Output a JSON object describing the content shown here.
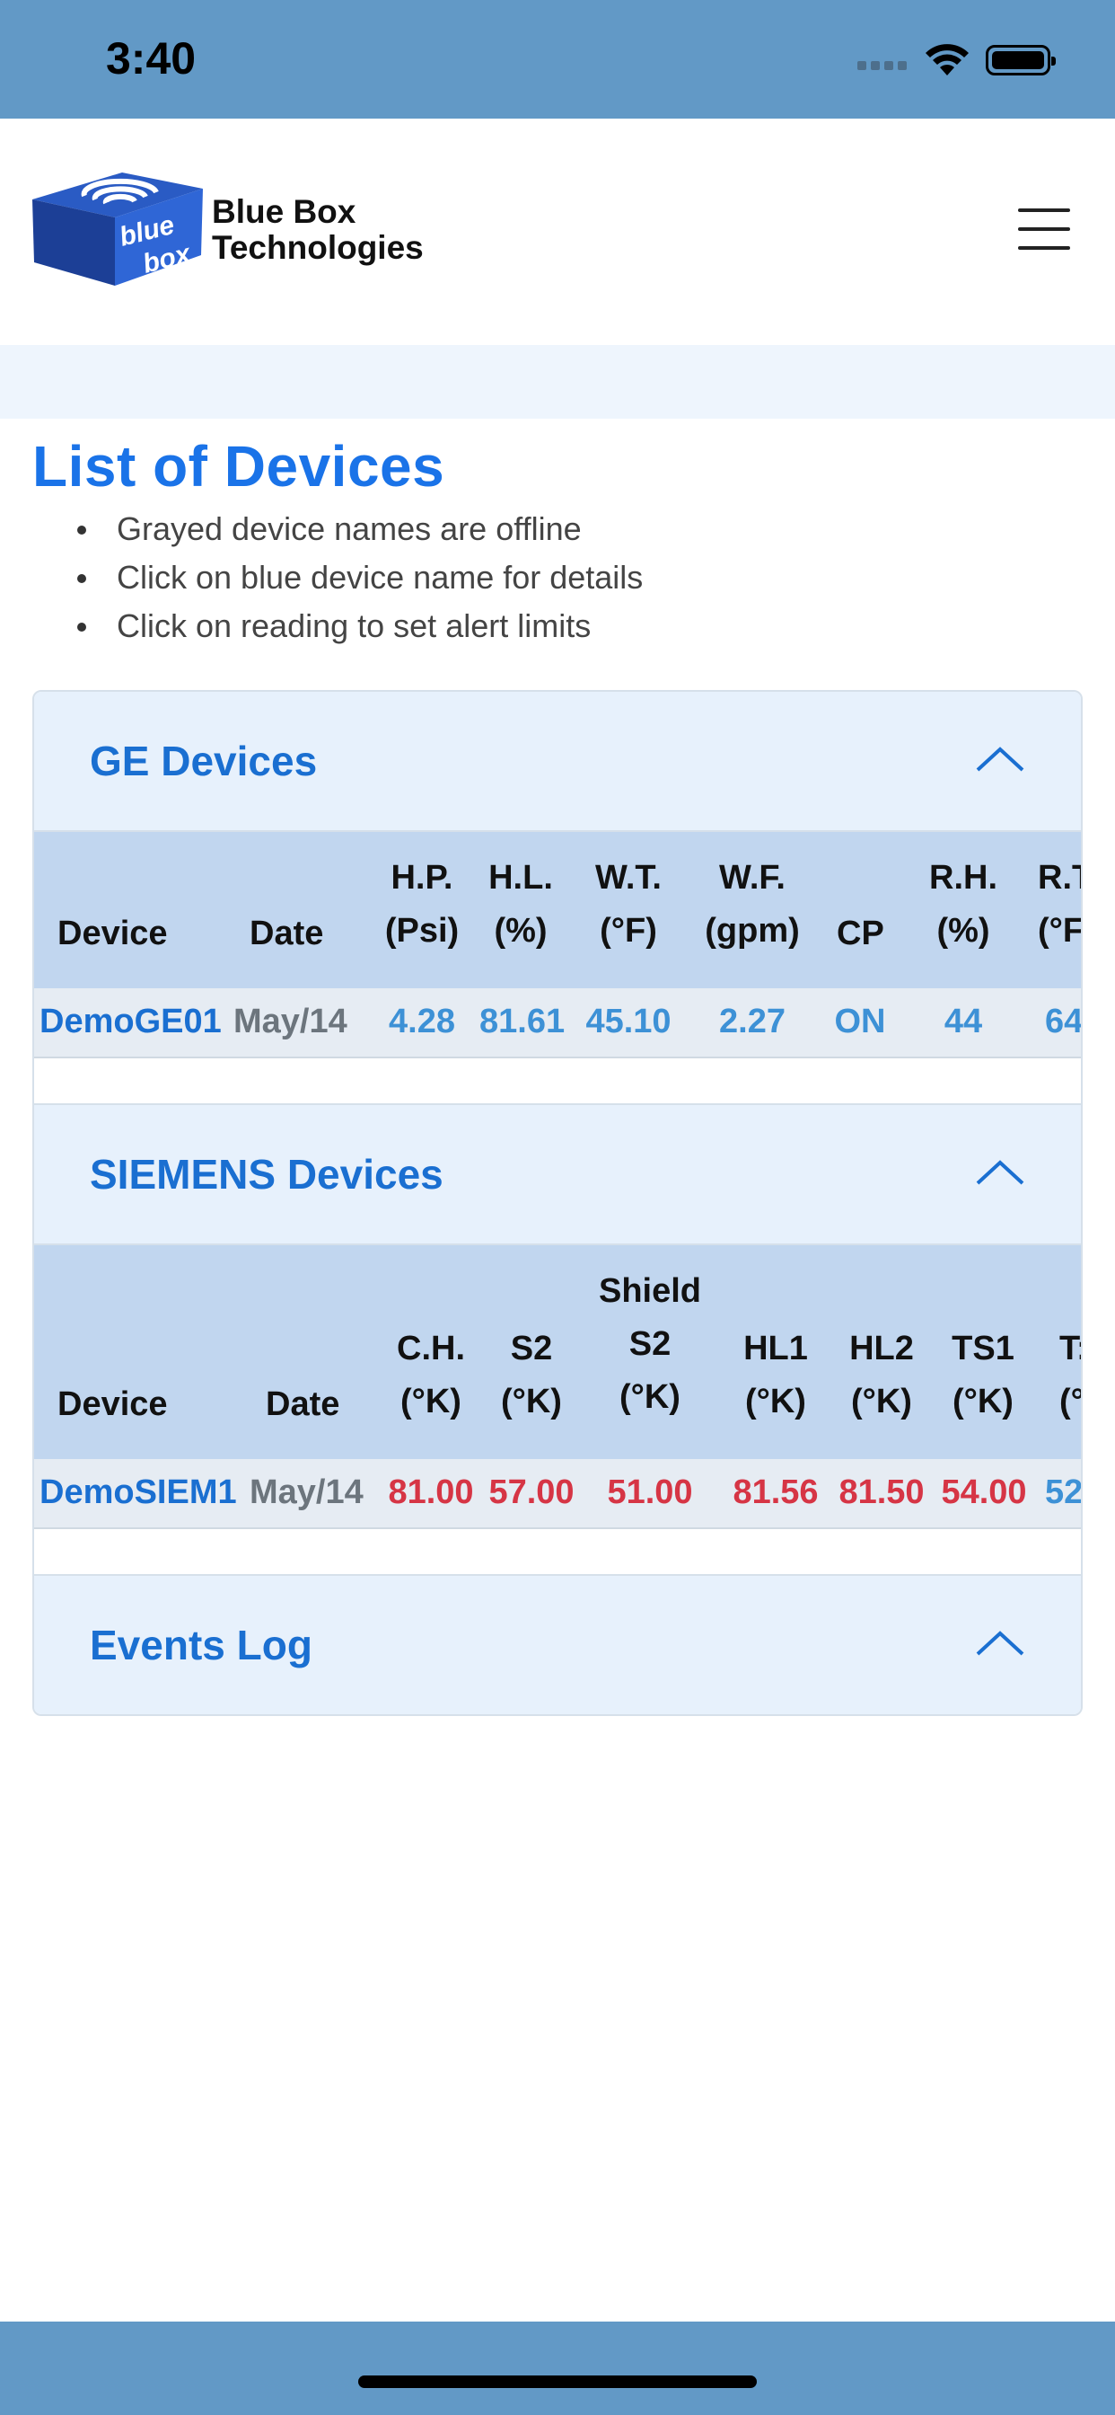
{
  "status_bar": {
    "time": "3:40"
  },
  "header": {
    "brand_line1": "Blue Box",
    "brand_line2": "Technologies",
    "logo_word1": "blue",
    "logo_word2": "box",
    "colors": {
      "logo": "#1e4aa8",
      "accent": "#1a73e8"
    }
  },
  "page": {
    "title": "List of Devices",
    "bullets": [
      "Grayed device names are offline",
      "Click on blue device name for details",
      "Click on reading to set alert limits"
    ]
  },
  "ge": {
    "title": "GE Devices",
    "headers": {
      "device": "Device",
      "date": "Date",
      "hp1": "H.P.",
      "hp2": "(Psi)",
      "hl1": "H.L.",
      "hl2": "(%)",
      "wt1": "W.T.",
      "wt2": "(°F)",
      "wf1": "W.F.",
      "wf2": "(gpm)",
      "cp": "CP",
      "rh1": "R.H.",
      "rh2": "(%)",
      "rt1": "R.T",
      "rt2": "(°F"
    },
    "row": {
      "device": "DemoGE01",
      "date": "May/14",
      "hp": "4.28",
      "hl": "81.61",
      "wt": "45.10",
      "wf": "2.27",
      "cp": "ON",
      "rh": "44",
      "rt": "64"
    }
  },
  "siemens": {
    "title": "SIEMENS Devices",
    "headers": {
      "device": "Device",
      "date": "Date",
      "ch1": "C.H.",
      "ch2": "(°K)",
      "s2_1": "S2",
      "s2_2": "(°K)",
      "shield0": "Shield",
      "shield1": "S2",
      "shield2": "(°K)",
      "hl1_1": "HL1",
      "hl1_2": "(°K)",
      "hl2_1": "HL2",
      "hl2_2": "(°K)",
      "ts1_1": "TS1",
      "ts1_2": "(°K)",
      "ts2_1": "T:",
      "ts2_2": "(°"
    },
    "row": {
      "device": "DemoSIEM1",
      "date": "May/14",
      "ch": "81.00",
      "s2": "57.00",
      "shield_s2": "51.00",
      "hl1": "81.56",
      "hl2": "81.50",
      "ts1": "54.00",
      "ts2": "52"
    }
  },
  "events": {
    "title": "Events Log"
  }
}
